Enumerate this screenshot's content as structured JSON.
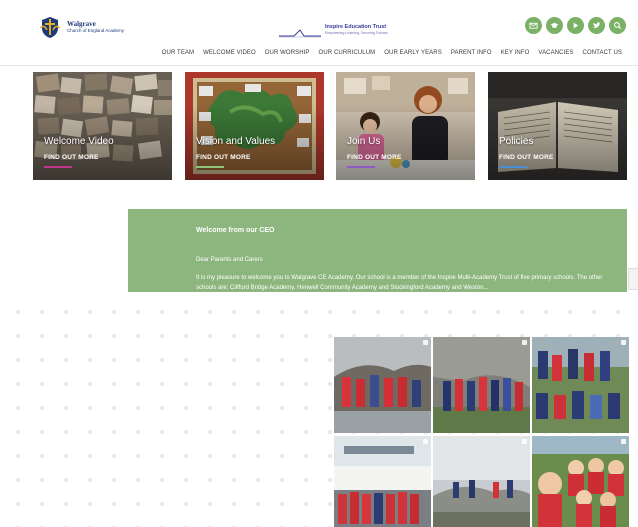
{
  "header": {
    "school_name": "Walgrave",
    "school_sub": "Church of England Academy",
    "trust_name": "Inspire Education Trust",
    "trust_sub": "Empowering Learning, Securing Futures"
  },
  "social": [
    {
      "name": "email-icon"
    },
    {
      "name": "graduation-cap-icon"
    },
    {
      "name": "play-icon"
    },
    {
      "name": "twitter-icon"
    },
    {
      "name": "search-icon"
    }
  ],
  "nav": [
    "OUR TEAM",
    "WELCOME VIDEO",
    "OUR WORSHIP",
    "OUR CURRICULUM",
    "OUR EARLY YEARS",
    "PARENT INFO",
    "KEY INFO",
    "VACANCIES",
    "CONTACT US"
  ],
  "cards": [
    {
      "title": "Welcome Video",
      "link": "FIND OUT MORE"
    },
    {
      "title": "Vision and Values",
      "link": "FIND OUT MORE"
    },
    {
      "title": "Join Us",
      "link": "FIND OUT MORE"
    },
    {
      "title": "Policies",
      "link": "FIND OUT MORE"
    }
  ],
  "welcome": {
    "title": "Welcome from our CEO",
    "greeting": "Dear Parents and Carers",
    "body": "It is my pleasure to welcome you to Walgrave CE Academy. Our school is a member of the Inspire Multi-Academy Trust of five primary schools. The other schools are: Clifford Bridge Academy, Henwell Community Academy and Stockingford Academy and Weston..."
  },
  "colors": {
    "accent_green": "#8cb67d",
    "social_green": "#7ab167",
    "nav_text": "#3a3a3a"
  }
}
